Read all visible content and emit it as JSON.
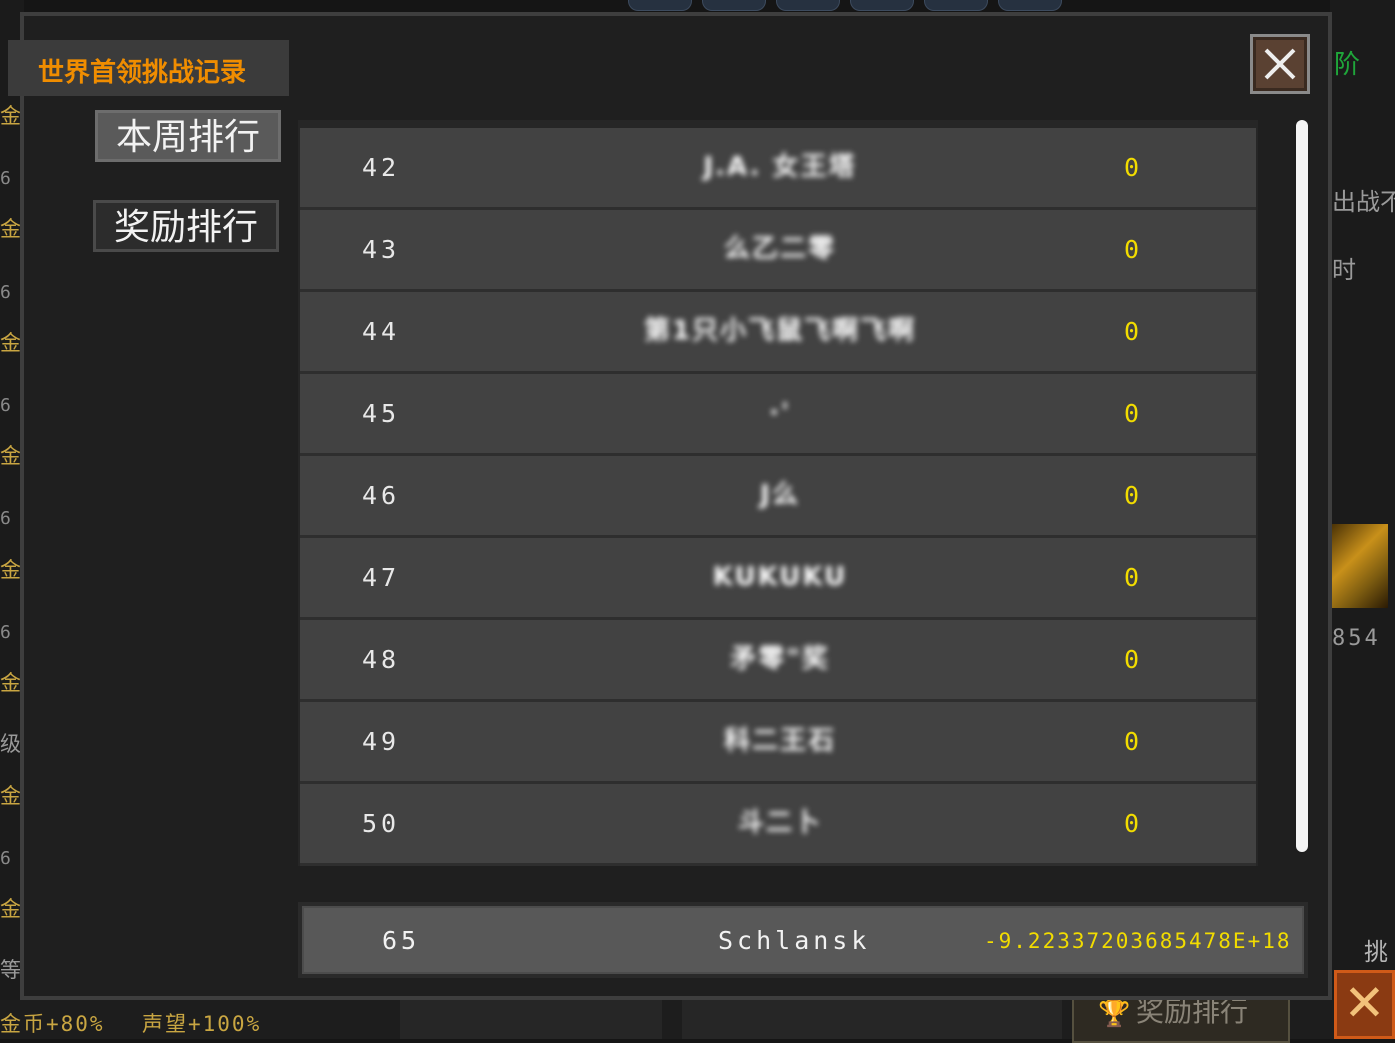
{
  "background": {
    "left_labels": [
      "金",
      "6",
      "金",
      "6",
      "金",
      "6",
      "金",
      "6",
      "金",
      "6",
      "金",
      "级",
      "金",
      "6",
      "金",
      "等"
    ],
    "right_labels": {
      "top": "阶",
      "line1": "出战不",
      "line2": "时",
      "number": "854",
      "challenge": "挑"
    },
    "bottom": {
      "gold_bonus": "金币+80%",
      "prestige_bonus": "声望+100%",
      "reward_rank_button": "奖励排行"
    }
  },
  "modal": {
    "title": "世界首领挑战记录",
    "close_label": "close",
    "tabs": [
      {
        "label": "本周排行",
        "active": true
      },
      {
        "label": "奖励排行",
        "active": false
      }
    ]
  },
  "ranking": {
    "rows": [
      {
        "rank": "42",
        "name": "J.A. 女王塔",
        "score": "0"
      },
      {
        "rank": "43",
        "name": "么乙二零",
        "score": "0"
      },
      {
        "rank": "44",
        "name": "第1只小飞鼠飞啊飞啊",
        "score": "0"
      },
      {
        "rank": "45",
        "name": "·'",
        "score": "0"
      },
      {
        "rank": "46",
        "name": "J么",
        "score": "0"
      },
      {
        "rank": "47",
        "name": "KUKUKU",
        "score": "0"
      },
      {
        "rank": "48",
        "name": "矛零\"奖",
        "score": "0"
      },
      {
        "rank": "49",
        "name": "科二王石",
        "score": "0"
      },
      {
        "rank": "50",
        "name": "斗二卜",
        "score": "0"
      }
    ],
    "my_rank": {
      "rank": "65",
      "name": "Schlansk",
      "score": "-9.22337203685478E+18"
    }
  },
  "colors": {
    "title": "#f08d00",
    "score": "#f2dc00",
    "row_bg": "#424242"
  }
}
